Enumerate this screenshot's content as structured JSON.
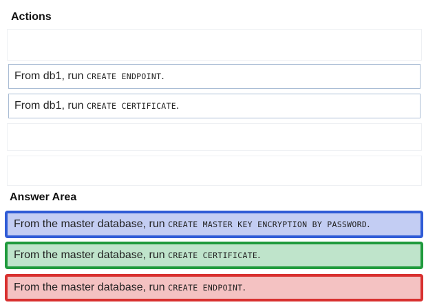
{
  "actions": {
    "title": "Actions",
    "items": [
      {
        "prefix": "From db1, run ",
        "code": "CREATE ENDPOINT",
        "suffix": "."
      },
      {
        "prefix": "From db1, run ",
        "code": "CREATE CERTIFICATE",
        "suffix": "."
      }
    ]
  },
  "answer_area": {
    "title": "Answer Area",
    "items": [
      {
        "prefix": "From the master database, run ",
        "code": "CREATE MASTER KEY ENCRYPTION BY PASSWORD",
        "suffix": ".",
        "border_color": "#2f5bd6",
        "fill_color": "#c3cdf3"
      },
      {
        "prefix": "From the master database, run ",
        "code": "CREATE CERTIFICATE",
        "suffix": ".",
        "border_color": "#1f9a3c",
        "fill_color": "#bfe4cb"
      },
      {
        "prefix": "From the master database, run ",
        "code": "CREATE ENDPOINT",
        "suffix": ".",
        "border_color": "#d8302f",
        "fill_color": "#f4c2c2"
      }
    ]
  }
}
